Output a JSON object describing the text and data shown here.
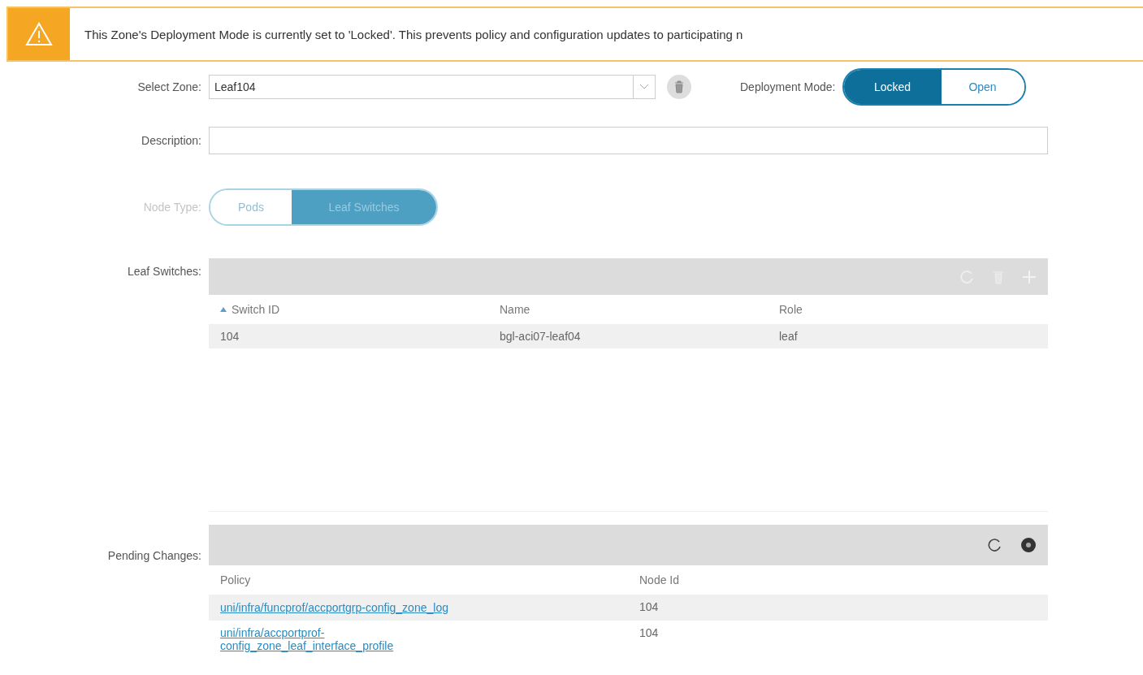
{
  "banner": {
    "message": "This Zone's Deployment Mode is currently set to 'Locked'. This prevents policy and configuration updates to participating n"
  },
  "select_zone": {
    "label": "Select Zone:",
    "value": "Leaf104"
  },
  "deployment_mode": {
    "label": "Deployment Mode:",
    "options": [
      {
        "label": "Locked",
        "selected": true
      },
      {
        "label": "Open",
        "selected": false
      }
    ]
  },
  "description": {
    "label": "Description:"
  },
  "node_type": {
    "label": "Node Type:",
    "disabled": true,
    "options": [
      {
        "label": "Pods",
        "selected": false
      },
      {
        "label": "Leaf Switches",
        "selected": true
      }
    ]
  },
  "leaf_switches": {
    "label": "Leaf Switches:",
    "columns": [
      {
        "label": "Switch ID",
        "sorted": true
      },
      {
        "label": "Name",
        "sorted": false
      },
      {
        "label": "Role",
        "sorted": false
      }
    ],
    "rows": [
      [
        "104",
        "bgl-aci07-leaf04",
        "leaf"
      ]
    ]
  },
  "pending_changes": {
    "label": "Pending Changes:",
    "columns": [
      "Policy",
      "Node Id"
    ],
    "rows": [
      {
        "policy": "uni/infra/funcprof/accportgrp-config_zone_log",
        "node_id": "104"
      },
      {
        "policy": "uni/infra/accportprof-config_zone_leaf_interface_profile",
        "node_id": "104"
      }
    ]
  }
}
